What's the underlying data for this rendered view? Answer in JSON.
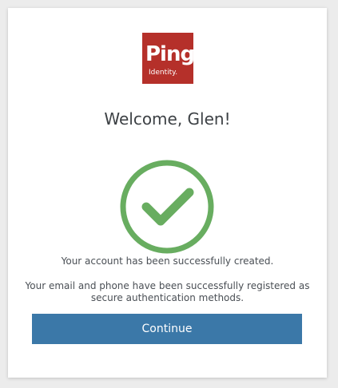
{
  "logo": {
    "word": "Ping",
    "subtitle": "Identity."
  },
  "welcome": {
    "title": "Welcome, Glen!"
  },
  "status": {
    "icon": "check-circle-icon",
    "icon_color": "#68ad60"
  },
  "messages": {
    "account_created": "Your account has been successfully created.",
    "methods_registered": "Your email and phone have been successfully registered as secure authentication methods."
  },
  "actions": {
    "continue_label": "Continue",
    "continue_color": "#3b78a8"
  },
  "colors": {
    "brand_red": "#b5302a",
    "success_green": "#68ad60"
  }
}
